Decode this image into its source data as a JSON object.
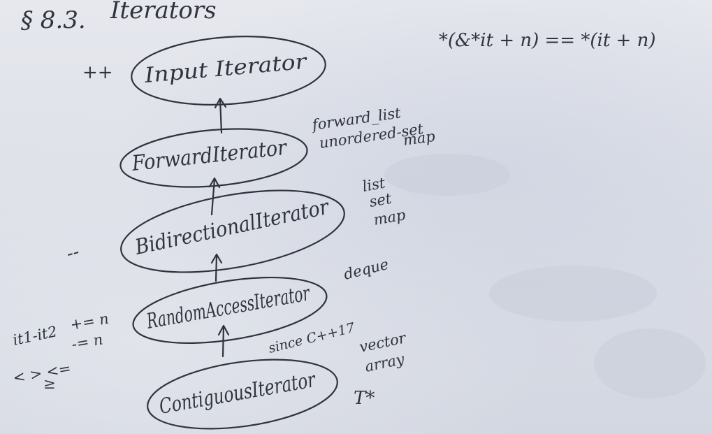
{
  "header": {
    "section_number": "§ 8.3.",
    "section_title": "Iterators"
  },
  "formula": "*(&*it + n) == *(it + n)",
  "nodes": [
    {
      "id": "input",
      "label": "Input Iterator"
    },
    {
      "id": "forward",
      "label": "ForwardIterator"
    },
    {
      "id": "bidirectional",
      "label": "BidirectionalIterator"
    },
    {
      "id": "random_access",
      "label": "RandomAccessIterator"
    },
    {
      "id": "contiguous",
      "label": "ContiguousIterator"
    }
  ],
  "edges": [
    {
      "from": "forward",
      "to": "input"
    },
    {
      "from": "bidirectional",
      "to": "forward"
    },
    {
      "from": "random_access",
      "to": "bidirectional"
    },
    {
      "from": "contiguous",
      "to": "random_access"
    }
  ],
  "annotations": {
    "input_ops": "++",
    "forward_containers": [
      "forward_list",
      "unordered-set",
      "map"
    ],
    "bidirectional_containers": [
      "list",
      "set",
      "map"
    ],
    "bidirectional_ops": "--",
    "random_access_containers": [
      "deque"
    ],
    "random_access_ops": [
      "it1-it2",
      "+= n",
      "< > <=",
      "-= n",
      "≥"
    ],
    "contiguous_since": "since C++17",
    "contiguous_containers": [
      "vector",
      "array"
    ],
    "contiguous_pointer": "T*"
  }
}
